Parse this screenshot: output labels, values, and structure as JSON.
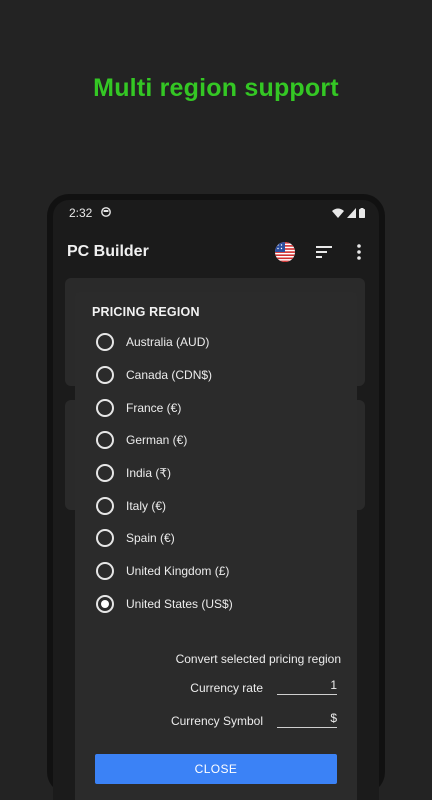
{
  "promo": {
    "title": "Multi region support"
  },
  "status_bar": {
    "time": "2:32"
  },
  "app_bar": {
    "title": "PC Builder",
    "icons": [
      "us-flag-icon",
      "sort-icon",
      "more-vert-icon"
    ]
  },
  "dialog": {
    "title": "PRICING REGION",
    "regions": [
      {
        "label": "Australia (AUD)",
        "selected": false
      },
      {
        "label": "Canada (CDN$)",
        "selected": false
      },
      {
        "label": "France (€)",
        "selected": false
      },
      {
        "label": "German (€)",
        "selected": false
      },
      {
        "label": "India (₹)",
        "selected": false
      },
      {
        "label": "Italy (€)",
        "selected": false
      },
      {
        "label": "Spain (€)",
        "selected": false
      },
      {
        "label": "United Kingdom (£)",
        "selected": false
      },
      {
        "label": "United States (US$)",
        "selected": true
      }
    ],
    "convert_label": "Convert selected pricing region",
    "currency_rate": {
      "label": "Currency rate",
      "value": "1"
    },
    "currency_symbol": {
      "label": "Currency Symbol",
      "value": "$"
    },
    "close_label": "CLOSE"
  },
  "colors": {
    "accent_green": "#34c724",
    "button_blue": "#3b82f6",
    "background": "#232323"
  }
}
